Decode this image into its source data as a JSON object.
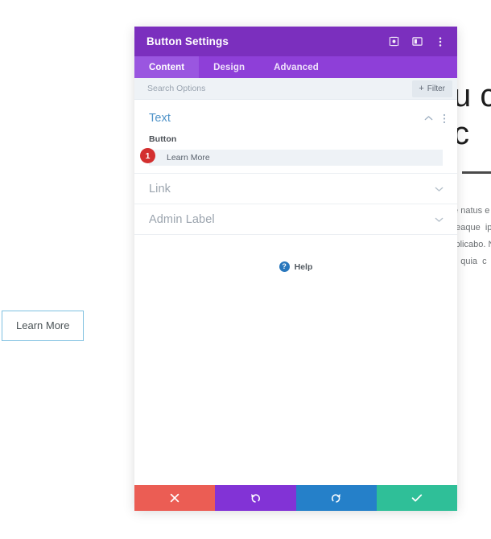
{
  "backdrop": {
    "heading_text": "u c\nc",
    "paragraph_text": "te natus e\n  eaque  ip\nxplicabo. N\nd  quia  c",
    "learn_more_button": "Learn More"
  },
  "modal": {
    "title": "Button Settings",
    "title_icons": [
      {
        "name": "expand-icon",
        "label": "Expand"
      },
      {
        "name": "layout-panel-icon",
        "label": "Layout"
      },
      {
        "name": "kebab-menu-icon",
        "label": "More options"
      }
    ],
    "tabs": [
      {
        "label": "Content",
        "active": true
      },
      {
        "label": "Design",
        "active": false
      },
      {
        "label": "Advanced",
        "active": false
      }
    ],
    "search": {
      "placeholder": "Search Options",
      "value": "",
      "filter_label": "Filter",
      "filter_plus": "+"
    },
    "sections": [
      {
        "title": "Text",
        "state": "expanded",
        "field_label": "Button",
        "field_value": "Learn More",
        "badge": "1"
      },
      {
        "title": "Link",
        "state": "collapsed"
      },
      {
        "title": "Admin Label",
        "state": "collapsed"
      }
    ],
    "help": {
      "icon_glyph": "?",
      "label": "Help"
    },
    "footer_buttons": [
      {
        "name": "cancel-button",
        "icon": "close-icon",
        "color": "#eb5d54"
      },
      {
        "name": "undo-button",
        "icon": "undo-icon",
        "color": "#8233d6"
      },
      {
        "name": "redo-button",
        "icon": "redo-icon",
        "color": "#2580c9"
      },
      {
        "name": "save-button",
        "icon": "check-icon",
        "color": "#2fbf98"
      }
    ]
  },
  "colors": {
    "titlebar": "#7b2fbe",
    "tabbar": "#8e3fd8",
    "tab_active": "#9a56e0",
    "section_title": "#4f93c8",
    "badge": "#d32f2f",
    "help_icon": "#2a78bd"
  }
}
